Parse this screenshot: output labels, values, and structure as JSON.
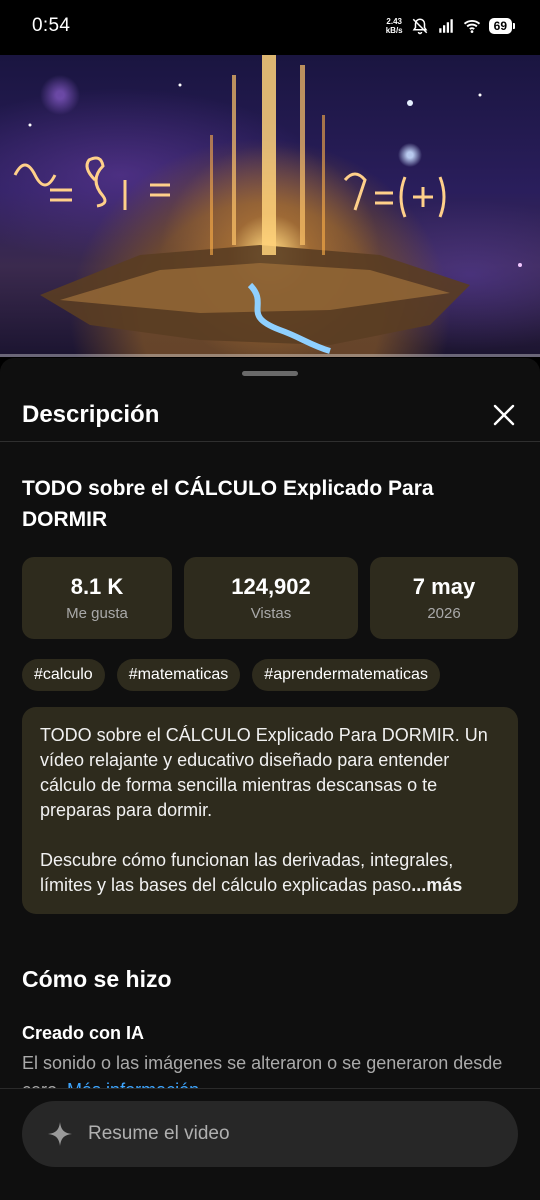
{
  "status_bar": {
    "time": "0:54",
    "net_speed_value": "2.43",
    "net_speed_unit": "kB/s",
    "battery": "69"
  },
  "sheet": {
    "title": "Descripción"
  },
  "video": {
    "title": "TODO sobre el CÁLCULO Explicado Para DORMIR",
    "progress": 0
  },
  "stats": [
    {
      "value": "8.1 K",
      "label": "Me gusta"
    },
    {
      "value": "124,902",
      "label": "Vistas"
    },
    {
      "value": "7 may",
      "label": "2026"
    }
  ],
  "tags": [
    "#calculo",
    "#matematicas",
    "#aprendermatematicas"
  ],
  "description": {
    "paragraph1": "TODO sobre el CÁLCULO Explicado Para DORMIR. Un vídeo relajante y educativo diseñado para entender cálculo de forma sencilla mientras descansas o te preparas para dormir.",
    "paragraph2": "Descubre cómo funcionan las derivadas, integrales, límites y las bases del cálculo explicadas paso",
    "more_label": "...más"
  },
  "how_made": {
    "section_title": "Cómo se hizo",
    "title": "Creado con IA",
    "text": "El sonido o las imágenes se alteraron o se generaron desde cero.",
    "link": "Más información"
  },
  "summary": {
    "placeholder": "Resume el video"
  },
  "colors": {
    "card_bg": "#2e2b1d",
    "sheet_bg": "#0f0f0f",
    "link": "#3ea6ff"
  }
}
